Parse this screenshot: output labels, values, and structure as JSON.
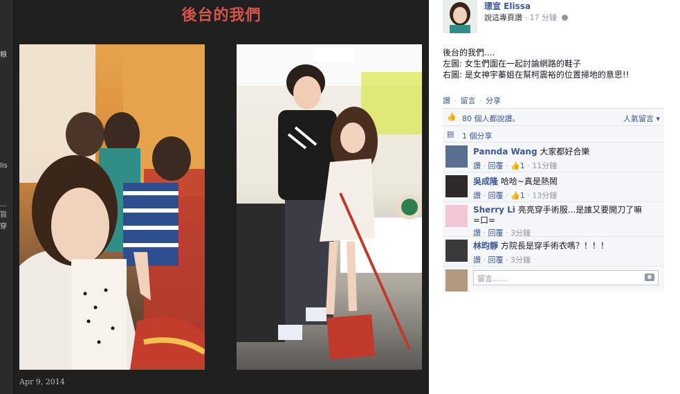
{
  "underlay": {
    "fragments": [
      "粮",
      "lis",
      "...",
      "旨",
      "穿"
    ]
  },
  "photo": {
    "title": "後台的我們",
    "date": "Apr 9, 2014"
  },
  "post": {
    "author": "璟宣 Elissa",
    "meta_prefix": "說這專頁讚",
    "meta_sep": "·",
    "time": "17 分鐘",
    "text_lines": [
      "後台的我們....",
      "左圖: 女生們圍在一起討論網路的鞋子",
      "右圖: 是女神宇蓁姐在幫柯震裕的位置掃地的意思!!"
    ],
    "actions": [
      "讚",
      "留言",
      "分享"
    ]
  },
  "ufi": {
    "likes_text": "80 個人都說讚。",
    "likes_sort": "人氣留言",
    "shares_text": "1 個分享",
    "comments": [
      {
        "name": "Pannda Wang",
        "text": "大家都好合樂",
        "like": "讚",
        "reply": "回覆",
        "likes": "1",
        "time": "11分鐘"
      },
      {
        "name": "吳成隆",
        "text": "哈哈~真是熱鬧",
        "like": "讚",
        "reply": "回覆",
        "likes": "1",
        "time": "13分鐘"
      },
      {
        "name": "Sherry Li",
        "text": "亮亮穿手術服...是誰又要開刀了嘛",
        "text2": "=口=",
        "like": "讚",
        "reply": "回覆",
        "time": "3分鐘"
      },
      {
        "name": "林昀靜",
        "text": "方院長是穿手術衣嗎？！！！",
        "like": "讚",
        "reply": "回覆",
        "time": "3分鐘"
      }
    ],
    "composer_placeholder": "留言......"
  },
  "colors": {
    "link": "#3b5998",
    "title": "#d9544a",
    "stage_bg": "#1f1f1f"
  },
  "icons": {
    "like": "thumbs-up-icon",
    "share": "share-icon",
    "camera": "camera-icon",
    "globe": "globe-icon"
  }
}
